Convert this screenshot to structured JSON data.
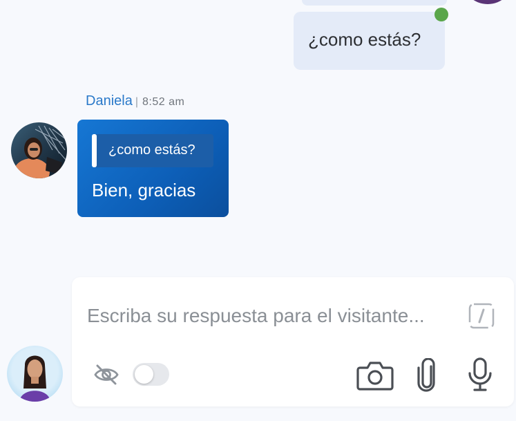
{
  "conversation": {
    "outgoing_message": {
      "text": "¿como estás?",
      "status_color": "#5aa64a"
    },
    "incoming_message": {
      "sender": "Daniela",
      "separator": "|",
      "time": "8:52 am",
      "quoted_text": "¿como estás?",
      "text": "Bien, gracias"
    }
  },
  "composer": {
    "placeholder": "Escriba su respuesta para el visitante...",
    "shortcut_icon": "slash-command-icon",
    "visibility_icon": "eye-off-icon",
    "toggle_on": false,
    "actions": [
      "camera-icon",
      "attachment-icon",
      "microphone-icon"
    ]
  },
  "colors": {
    "accent_blue": "#1677d4",
    "sender_name": "#2a79c9",
    "outgoing_bubble": "#e4ebf8"
  }
}
